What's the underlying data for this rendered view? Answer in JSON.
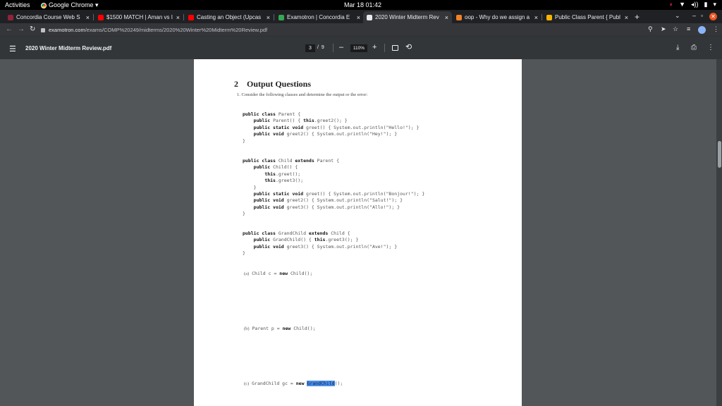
{
  "system_bar": {
    "activities": "Activities",
    "app_name": "Google Chrome ▾",
    "clock": "Mar 18  01:42"
  },
  "tabs": [
    {
      "title": "Concordia Course Web S",
      "favicon_color": "#912338",
      "active": false
    },
    {
      "title": "$1500 MATCH | Aman vs I",
      "favicon_color": "#ff0000",
      "active": false
    },
    {
      "title": "Casting an Object (Upcas",
      "favicon_color": "#ff0000",
      "active": false
    },
    {
      "title": "Examotron | Concordia E",
      "favicon_color": "#34a853",
      "active": false
    },
    {
      "title": "2020 Winter Midterm Rev",
      "favicon_color": "#e8eaed",
      "active": true
    },
    {
      "title": "oop - Why do we assign a",
      "favicon_color": "#f48024",
      "active": false
    },
    {
      "title": "Public Class Parent { Publ",
      "favicon_color": "#f4b400",
      "active": false
    }
  ],
  "address_bar": {
    "host": "examotron.com",
    "path": "/exams/COMP%20249/midterms/2020%20Winter%20Midterm%20Review.pdf"
  },
  "pdf_viewer": {
    "filename": "2020 Winter Midterm Review.pdf",
    "current_page": "3",
    "page_sep": "/",
    "total_pages": "9",
    "zoom": "110%"
  },
  "document": {
    "section_number": "2",
    "section_title": "Output Questions",
    "instruction": "1. Consider the following classes and determine the output or the error:",
    "class_blocks": [
      {
        "lines": [
          [
            [
              "kw",
              "public class "
            ],
            [
              "t",
              "Parent {"
            ]
          ],
          [
            [
              "t",
              "    "
            ],
            [
              "kw",
              "public "
            ],
            [
              "t",
              "Parent() { "
            ],
            [
              "kw",
              "this"
            ],
            [
              "t",
              ".greet2(); }"
            ]
          ],
          [
            [
              "t",
              "    "
            ],
            [
              "kw",
              "public static void "
            ],
            [
              "t",
              "greet() { System.out.println(\"Hello!\"); }"
            ]
          ],
          [
            [
              "t",
              "    "
            ],
            [
              "kw",
              "public void "
            ],
            [
              "t",
              "greet2() { System.out.println(\"Hey!\"); }"
            ]
          ],
          [
            [
              "t",
              "}"
            ]
          ]
        ]
      },
      {
        "lines": [
          [
            [
              "kw",
              "public class "
            ],
            [
              "t",
              "Child "
            ],
            [
              "kw",
              "extends "
            ],
            [
              "t",
              "Parent {"
            ]
          ],
          [
            [
              "t",
              "    "
            ],
            [
              "kw",
              "public "
            ],
            [
              "t",
              "Child() {"
            ]
          ],
          [
            [
              "t",
              "        "
            ],
            [
              "kw",
              "this"
            ],
            [
              "t",
              ".greet();"
            ]
          ],
          [
            [
              "t",
              "        "
            ],
            [
              "kw",
              "this"
            ],
            [
              "t",
              ".greet3();"
            ]
          ],
          [
            [
              "t",
              "    }"
            ]
          ],
          [
            [
              "t",
              "    "
            ],
            [
              "kw",
              "public static void "
            ],
            [
              "t",
              "greet() { System.out.println(\"Bonjour!\"); }"
            ]
          ],
          [
            [
              "t",
              "    "
            ],
            [
              "kw",
              "public void "
            ],
            [
              "t",
              "greet2() { System.out.println(\"Salut!\"); }"
            ]
          ],
          [
            [
              "t",
              "    "
            ],
            [
              "kw",
              "public void "
            ],
            [
              "t",
              "greet3() { System.out.println(\"Allo!\"); }"
            ]
          ],
          [
            [
              "t",
              "}"
            ]
          ]
        ]
      },
      {
        "lines": [
          [
            [
              "kw",
              "public class "
            ],
            [
              "t",
              "GrandChild "
            ],
            [
              "kw",
              "extends "
            ],
            [
              "t",
              "Child {"
            ]
          ],
          [
            [
              "t",
              "    "
            ],
            [
              "kw",
              "public "
            ],
            [
              "t",
              "GrandChild() { "
            ],
            [
              "kw",
              "this"
            ],
            [
              "t",
              ".greet3(); }"
            ]
          ],
          [
            [
              "t",
              "    "
            ],
            [
              "kw",
              "public void "
            ],
            [
              "t",
              "greet3() { System.out.println(\"Ave!\"); }"
            ]
          ],
          [
            [
              "t",
              "}"
            ]
          ]
        ]
      }
    ],
    "questions": [
      {
        "label": "(a)",
        "code": [
          [
            "t",
            "Child c = "
          ],
          [
            "kw",
            "new "
          ],
          [
            "t",
            "Child();"
          ]
        ]
      },
      {
        "label": "(b)",
        "code": [
          [
            "t",
            "Parent p = "
          ],
          [
            "kw",
            "new "
          ],
          [
            "t",
            "Child();"
          ]
        ]
      },
      {
        "label": "(c)",
        "code": [
          [
            "t",
            "GrandChild gc = "
          ],
          [
            "kw",
            "new "
          ],
          [
            "hl",
            "GrandChild"
          ],
          [
            "t",
            "();"
          ]
        ]
      }
    ]
  }
}
